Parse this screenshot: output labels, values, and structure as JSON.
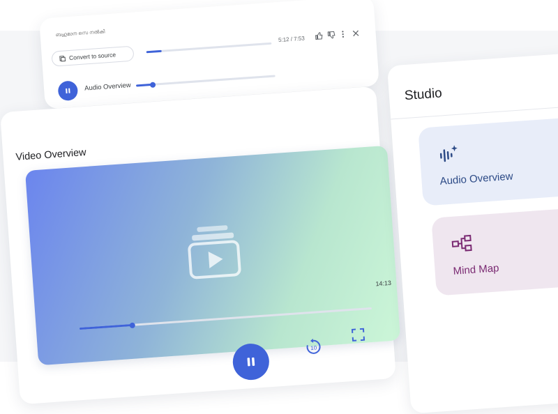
{
  "audio_player": {
    "source_text": "ബഹുമാന സെ നൽകി",
    "convert_label": "Convert to source",
    "time": "5:12 / 7:53",
    "label": "Audio Overview",
    "progress": 0.12,
    "icons": [
      "convert-icon",
      "thumb-up-icon",
      "thumb-down-icon",
      "more-vert-icon",
      "close-icon",
      "pause-icon"
    ]
  },
  "video_card": {
    "title": "Video Overview",
    "duration": "14:13",
    "progress": 0.18,
    "icons": [
      "video-stack-icon",
      "pause-icon",
      "replay-10-icon",
      "fullscreen-icon"
    ]
  },
  "studio": {
    "title": "Studio",
    "tiles": [
      {
        "label": "Audio Overview",
        "icon": "audio-waveform-icon",
        "color": "#2c4a86"
      },
      {
        "label": "Mind Map",
        "icon": "mind-map-icon",
        "color": "#7a2a72"
      }
    ]
  },
  "colors": {
    "accent": "#3f63d9",
    "gradient_start": "#6b85ee",
    "gradient_end": "#ccf6d8"
  }
}
